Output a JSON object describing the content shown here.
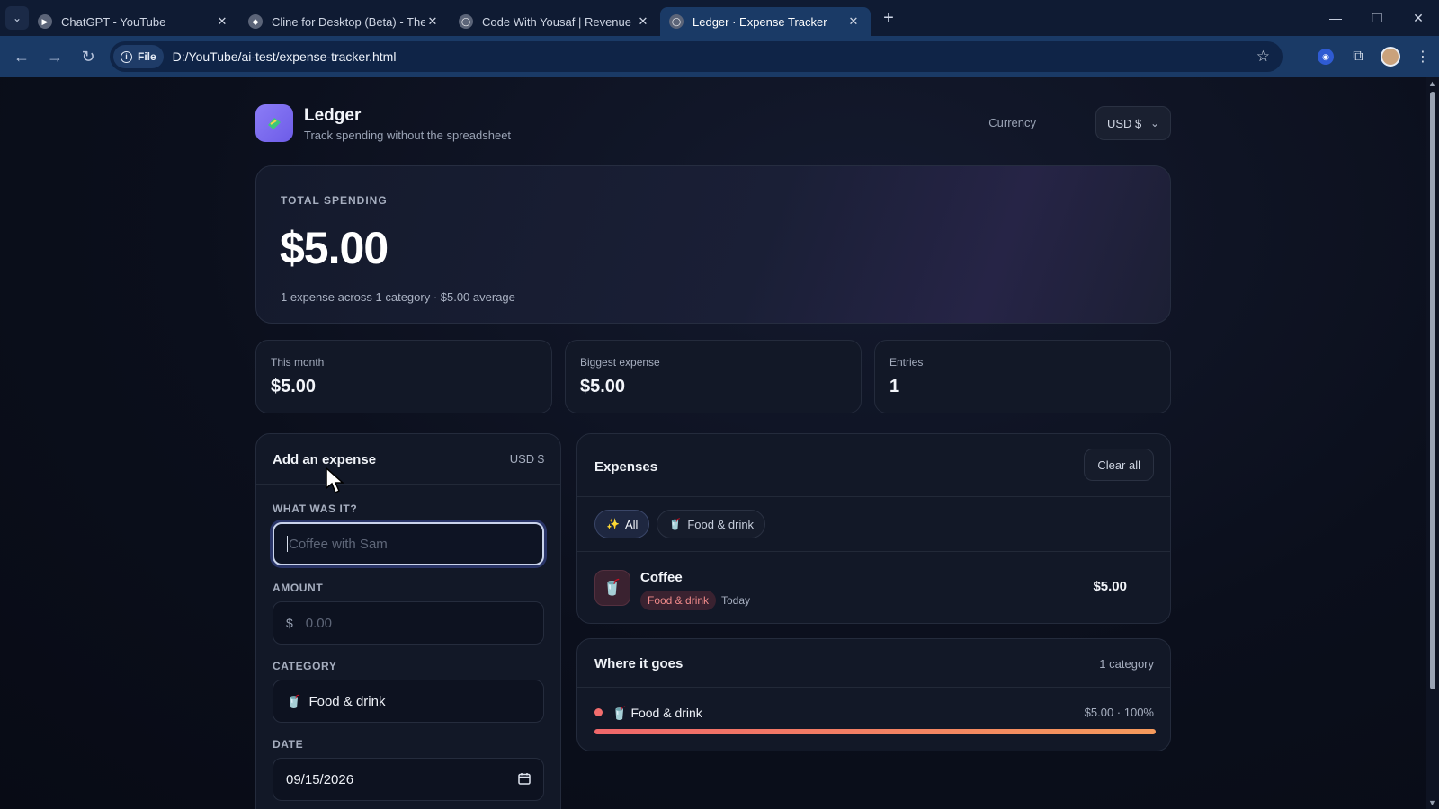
{
  "browser": {
    "tabs": [
      {
        "title": "ChatGPT - YouTube",
        "icon": "youtube-favicon"
      },
      {
        "title": "Cline for Desktop (Beta) - The C",
        "icon": "cline-favicon"
      },
      {
        "title": "Code With Yousaf | Revenue & C",
        "icon": "globe-favicon"
      },
      {
        "title": "Ledger · Expense Tracker",
        "icon": "globe-favicon"
      }
    ],
    "active_tab": 3,
    "omnibox": {
      "chip": "File",
      "url": "D:/YouTube/ai-test/expense-tracker.html"
    }
  },
  "app": {
    "name": "Ledger",
    "tagline": "Track spending without the spreadsheet",
    "currency_label": "Currency",
    "currency_value": "USD $"
  },
  "summary": {
    "label": "TOTAL SPENDING",
    "total": "$5.00",
    "subtitle": "1 expense across 1 category · $5.00 average"
  },
  "stats": [
    {
      "label": "This month",
      "value": "$5.00"
    },
    {
      "label": "Biggest expense",
      "value": "$5.00"
    },
    {
      "label": "Entries",
      "value": "1"
    }
  ],
  "form": {
    "title": "Add an expense",
    "currency": "USD $",
    "what_label": "WHAT WAS IT?",
    "what_placeholder": "Coffee with Sam",
    "amount_label": "AMOUNT",
    "amount_prefix": "$",
    "amount_placeholder": "0.00",
    "category_label": "CATEGORY",
    "category_value": "Food & drink",
    "date_label": "DATE",
    "date_value": "09/15/2026"
  },
  "expenses": {
    "title": "Expenses",
    "clear_label": "Clear all",
    "filters": [
      {
        "label": "All",
        "icon": "sparkle-icon",
        "active": true
      },
      {
        "label": "Food & drink",
        "icon": "drink-icon",
        "active": false
      }
    ],
    "items": [
      {
        "name": "Coffee",
        "category": "Food & drink",
        "date": "Today",
        "amount": "$5.00"
      }
    ]
  },
  "breakdown": {
    "title": "Where it goes",
    "count": "1 category",
    "items": [
      {
        "name": "Food & drink",
        "amount": "$5.00 · 100%",
        "fraction": 1.0,
        "color": "#f26d6d"
      }
    ]
  }
}
